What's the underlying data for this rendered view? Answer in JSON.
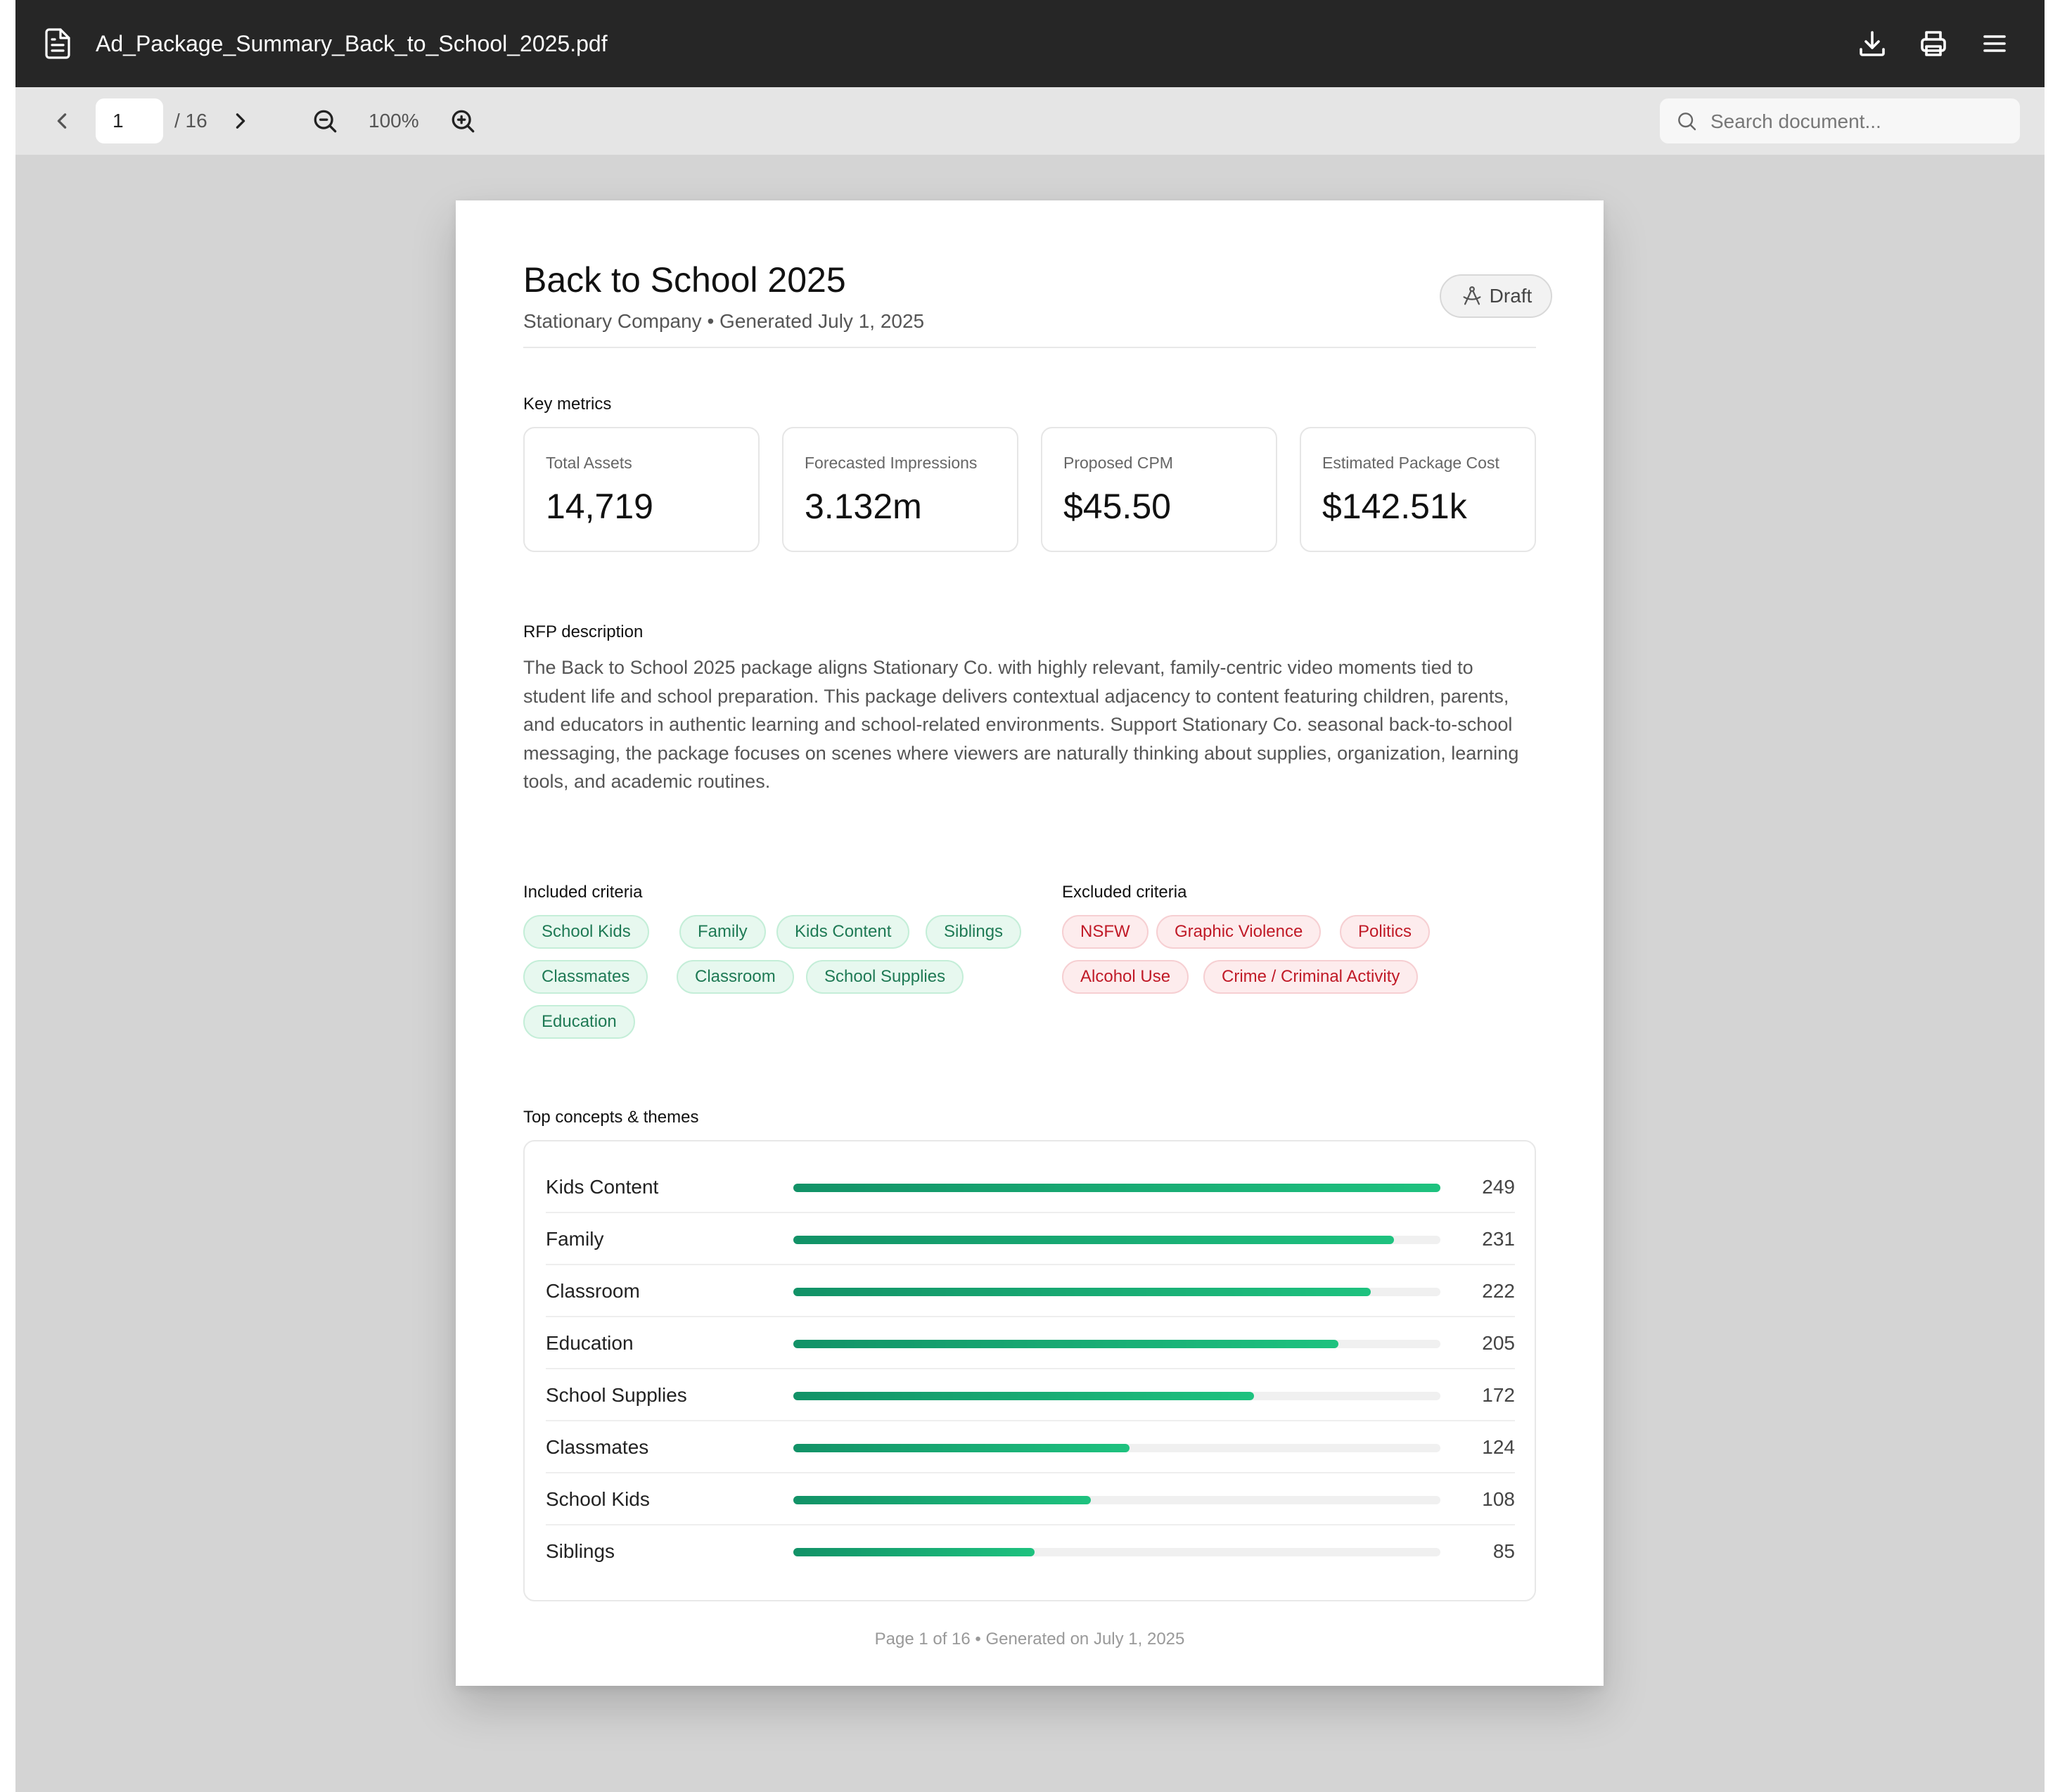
{
  "window": {
    "filename": "Ad_Package_Summary_Back_to_School_2025.pdf"
  },
  "toolbar": {
    "current_page": "1",
    "total_pages": "/ 16",
    "zoom": "100%",
    "search_placeholder": "Search document..."
  },
  "document": {
    "title": "Back to School 2025",
    "subtitle": "Stationary Company • Generated July 1, 2025",
    "status_badge": "Draft",
    "key_metrics_label": "Key metrics",
    "metrics": [
      {
        "label": "Total Assets",
        "value": "14,719"
      },
      {
        "label": "Forecasted Impressions",
        "value": "3.132m"
      },
      {
        "label": "Proposed CPM",
        "value": "$45.50"
      },
      {
        "label": "Estimated Package Cost",
        "value": "$142.51k"
      }
    ],
    "rfp_label": "RFP description",
    "rfp_text": "The Back to School 2025 package aligns Stationary Co. with highly relevant, family-centric video moments tied to student life and school preparation. This package delivers contextual adjacency to content featuring children, parents, and educators in authentic learning and school-related environments. Support Stationary Co. seasonal back-to-school messaging, the package focuses on scenes where viewers are naturally thinking about supplies, organization, learning tools, and academic routines.",
    "included_label": "Included criteria",
    "included": [
      "School Kids",
      "Family",
      "Kids Content",
      "Siblings",
      "Classmates",
      "Classroom",
      "School Supplies",
      "Education"
    ],
    "excluded_label": "Excluded criteria",
    "excluded": [
      "NSFW",
      "Graphic Violence",
      "Politics",
      "Alcohol Use",
      "Crime / Criminal Activity"
    ],
    "concepts_label": "Top concepts & themes",
    "concepts": [
      {
        "label": "Kids Content",
        "value": "249",
        "fraction": 1.0
      },
      {
        "label": "Family",
        "value": "231",
        "fraction": 0.928
      },
      {
        "label": "Classroom",
        "value": "222",
        "fraction": 0.892
      },
      {
        "label": "Education",
        "value": "205",
        "fraction": 0.842
      },
      {
        "label": "School Supplies",
        "value": "172",
        "fraction": 0.712
      },
      {
        "label": "Classmates",
        "value": "124",
        "fraction": 0.52
      },
      {
        "label": "School Kids",
        "value": "108",
        "fraction": 0.46
      },
      {
        "label": "Siblings",
        "value": "85",
        "fraction": 0.373
      }
    ],
    "footer": "Page 1 of 16 • Generated on July 1, 2025"
  },
  "colors": {
    "bar_start": "#129267",
    "bar_end": "#1ec27f",
    "included_chip": "#1f7a55",
    "excluded_chip": "#c01a27"
  }
}
